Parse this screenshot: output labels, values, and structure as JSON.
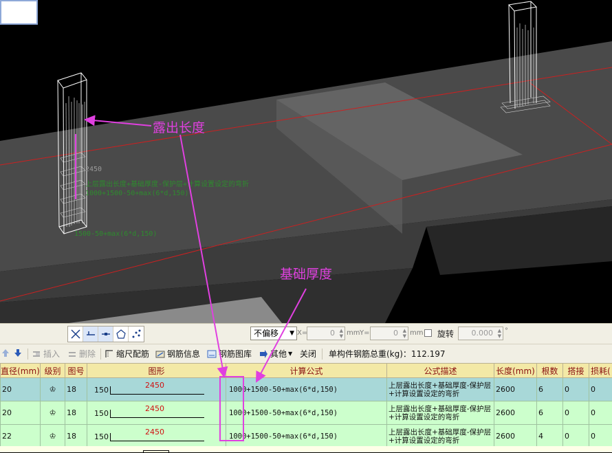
{
  "viewport": {
    "annotation_exposed_length": "露出长度",
    "annotation_foundation_thickness": "基础厚度",
    "rebar_label_length": "2450",
    "rebar_label_desc": "上层露出长度+基础厚度-保护层+计算设置设定的弯折",
    "rebar_label_formula": "1000+1500-50+max(6*d,150)",
    "rebar_label_formula2": "1500-50+max(6*d,150)"
  },
  "toolbar_top": {
    "offset_select": "不偏移",
    "x_label": "X=",
    "x_value": "0",
    "x_unit": "mm",
    "y_label": "Y=",
    "y_value": "0",
    "y_unit": "mm",
    "rotate_label": "旋转",
    "rotate_value": "0.000",
    "rotate_unit": "°"
  },
  "toolbar_bottom": {
    "insert": "插入",
    "delete": "删除",
    "scale_rebar": "缩尺配筋",
    "rebar_info": "钢筋信息",
    "rebar_library": "钢筋图库",
    "other": "其他",
    "close": "关闭",
    "total_weight": "单构件钢筋总重(kg)：112.197"
  },
  "grid": {
    "headers": [
      "直径(mm)",
      "级别",
      "图号",
      "图形",
      "计算公式",
      "公式描述",
      "长度(mm)",
      "根数",
      "搭接",
      "损耗("
    ],
    "rows": [
      {
        "diameter": "20",
        "grade": "♔",
        "fig_no": "18",
        "shape_left": "150",
        "shape_len": "2450",
        "formula": "1000+1500-50+max(6*d,150)",
        "desc": "上层露出长度+基础厚度-保护层+计算设置设定的弯折",
        "length": "2600",
        "count": "6",
        "lap": "0",
        "loss": "0"
      },
      {
        "diameter": "20",
        "grade": "♔",
        "fig_no": "18",
        "shape_left": "150",
        "shape_len": "2450",
        "formula": "1000+1500-50+max(6*d,150)",
        "desc": "上层露出长度+基础厚度-保护层+计算设置设定的弯折",
        "length": "2600",
        "count": "6",
        "lap": "0",
        "loss": "0"
      },
      {
        "diameter": "22",
        "grade": "♔",
        "fig_no": "18",
        "shape_left": "150",
        "shape_len": "2450",
        "formula": "1000+1500-50+max(6*d,150)",
        "desc": "上层露出长度+基础厚度-保护层+计算设置设定的弯折",
        "length": "2600",
        "count": "4",
        "lap": "0",
        "loss": "0"
      }
    ]
  }
}
